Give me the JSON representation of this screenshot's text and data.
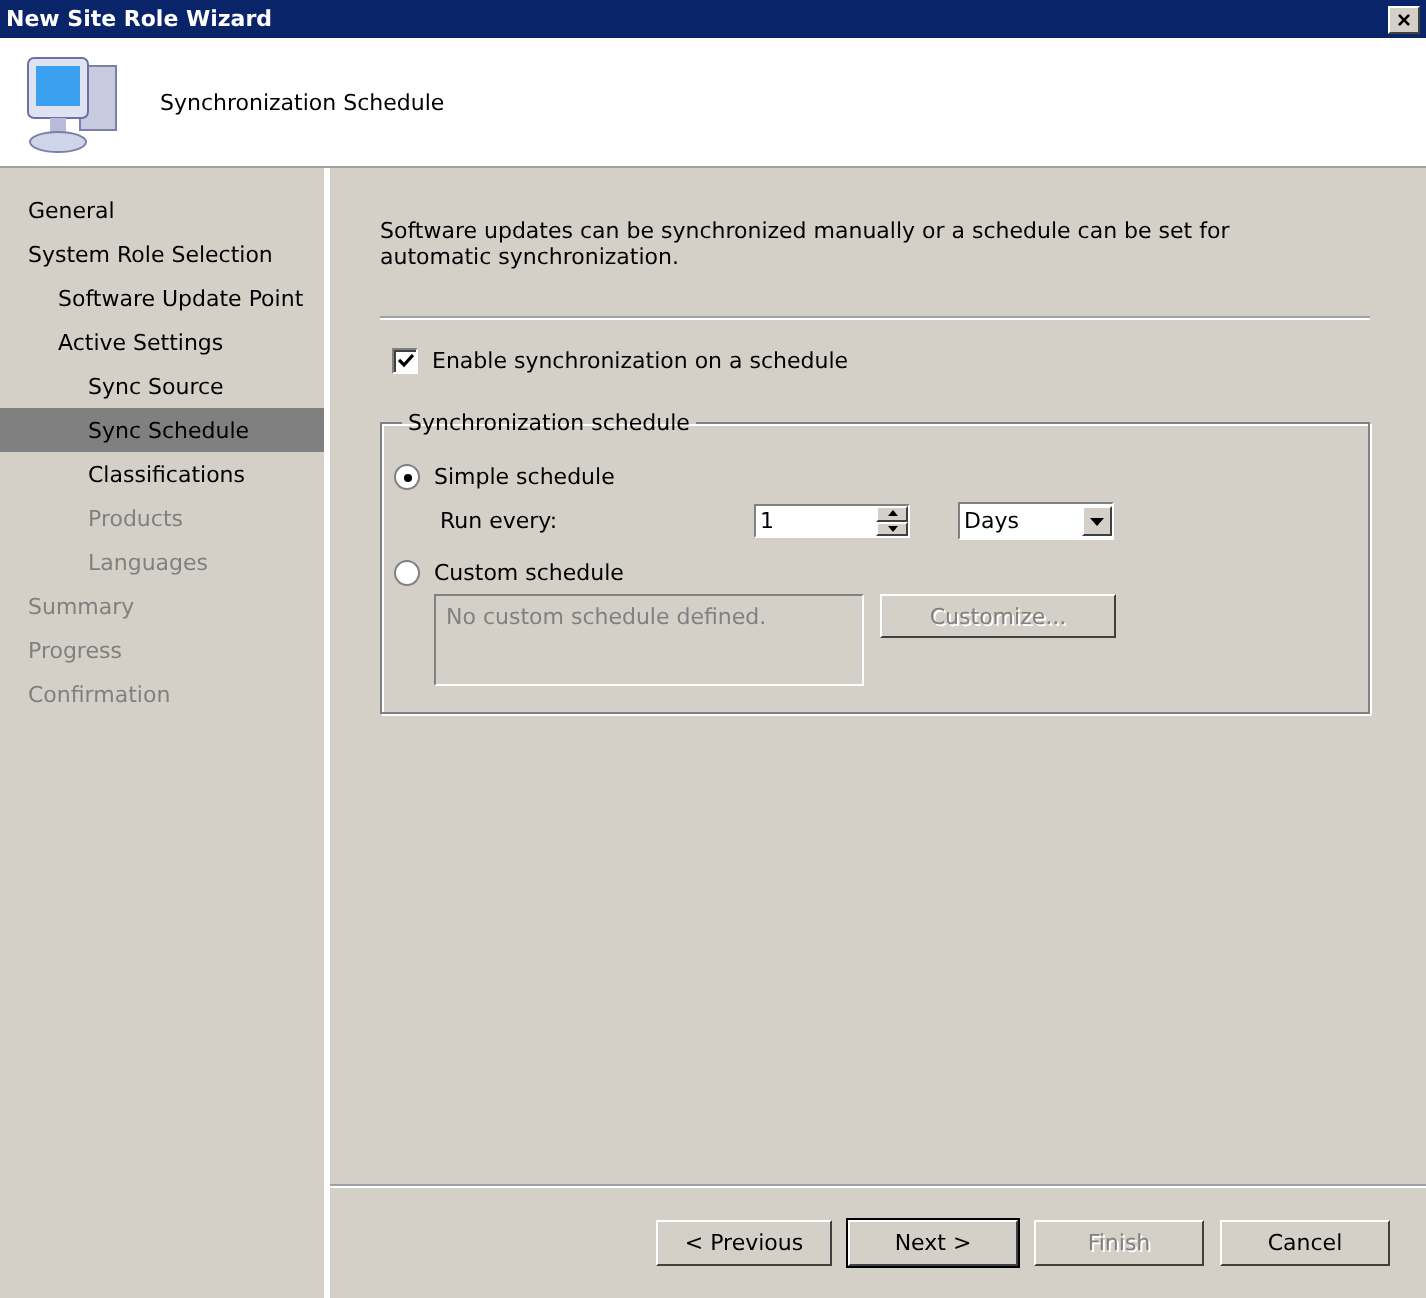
{
  "window": {
    "title": "New Site Role Wizard",
    "close": "×"
  },
  "header": {
    "title": "Synchronization Schedule"
  },
  "sidebar": {
    "items": [
      {
        "label": "General",
        "selected": false,
        "disabled": false
      },
      {
        "label": "System Role Selection",
        "selected": false,
        "disabled": false,
        "children": [
          {
            "label": "Software Update Point",
            "selected": false,
            "disabled": false
          },
          {
            "label": "Active Settings",
            "selected": false,
            "disabled": false,
            "children": [
              {
                "label": "Sync Source",
                "selected": false,
                "disabled": false
              },
              {
                "label": "Sync Schedule",
                "selected": true,
                "disabled": false
              },
              {
                "label": "Classifications",
                "selected": false,
                "disabled": false
              },
              {
                "label": "Products",
                "selected": false,
                "disabled": true
              },
              {
                "label": "Languages",
                "selected": false,
                "disabled": true
              }
            ]
          }
        ]
      },
      {
        "label": "Summary",
        "selected": false,
        "disabled": true
      },
      {
        "label": "Progress",
        "selected": false,
        "disabled": true
      },
      {
        "label": "Confirmation",
        "selected": false,
        "disabled": true
      }
    ]
  },
  "content": {
    "description": "Software updates can be synchronized manually or a schedule can be set for automatic synchronization.",
    "enable_checkbox": {
      "label": "Enable synchronization on a schedule",
      "checked": true
    },
    "group": {
      "title": "Synchronization schedule",
      "simple": {
        "label": "Simple schedule",
        "selected": true
      },
      "run_every": {
        "label": "Run every:",
        "value": "1",
        "unit": "Days"
      },
      "custom": {
        "label": "Custom schedule",
        "selected": false
      },
      "custom_text": {
        "value": "No custom schedule defined.",
        "disabled": true
      },
      "customize_button": {
        "label": "Customize...",
        "disabled": true
      }
    }
  },
  "buttons": [
    {
      "label": "< Previous",
      "default": false,
      "disabled": false
    },
    {
      "label": "Next >",
      "default": true,
      "disabled": false
    },
    {
      "label": "Finish",
      "default": false,
      "disabled": true
    },
    {
      "label": "Cancel",
      "default": false,
      "disabled": false
    }
  ]
}
